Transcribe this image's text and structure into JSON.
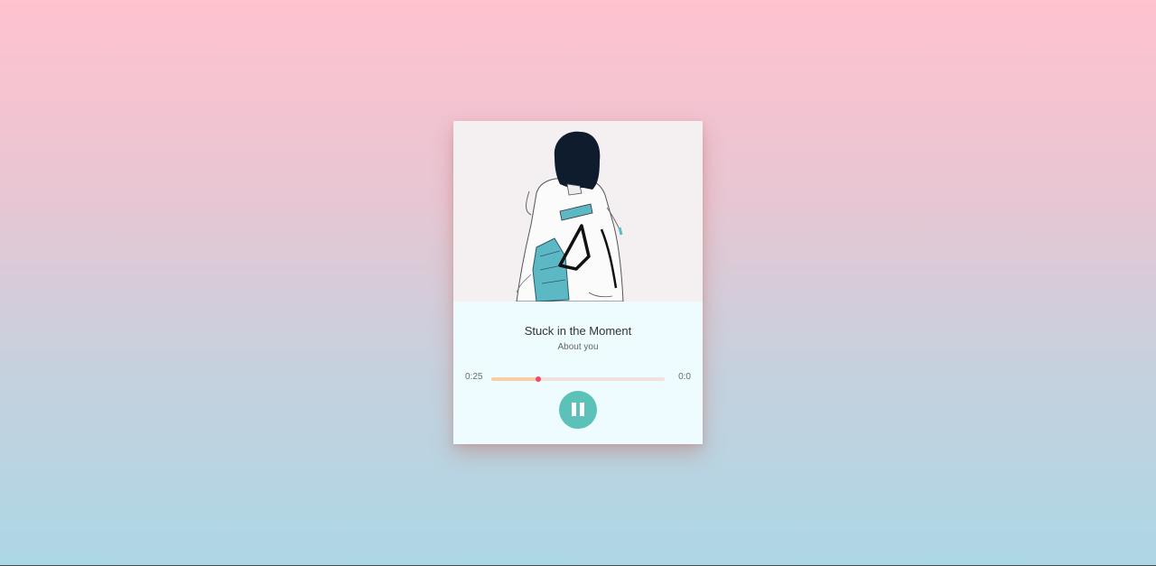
{
  "player": {
    "title": "Stuck in the Moment",
    "artist": "About you",
    "current_time": "0:25",
    "total_time": "0:0",
    "progress": 0.27,
    "state": "playing",
    "control_icon": "pause-icon",
    "accent_color": "#5cc2b9",
    "progress_color": "#f7cfa3",
    "thumb_color": "#f0476b"
  }
}
